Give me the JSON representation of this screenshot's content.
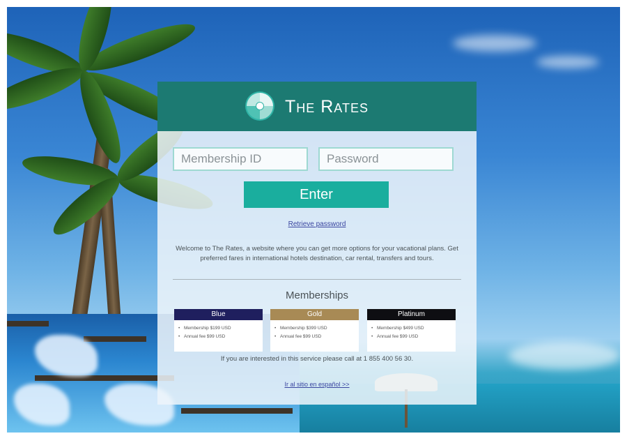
{
  "brand": {
    "name": "The Rates",
    "logo_icon": "swirl-logo-icon",
    "header_color": "#1c7a72"
  },
  "login": {
    "membership_placeholder": "Membership ID",
    "password_placeholder": "Password",
    "enter_label": "Enter",
    "retrieve_label": "Retrieve password",
    "button_color": "#1aae9e"
  },
  "welcome_text": "Welcome to The Rates, a website where you can get more options for your vacational plans. Get preferred fares in international hotels destination, car rental, transfers and tours.",
  "memberships": {
    "title": "Memberships",
    "cards": [
      {
        "name": "Blue",
        "color": "#1f1f5e",
        "items": [
          "Membership $199 USD",
          "Annual fee $99 USD"
        ]
      },
      {
        "name": "Gold",
        "color": "#a88a55",
        "items": [
          "Membership $399 USD",
          "Annual fee $99 USD"
        ]
      },
      {
        "name": "Platinum",
        "color": "#0e0e12",
        "items": [
          "Membership $499 USD",
          "Annual fee $99 USD"
        ]
      }
    ]
  },
  "call_text": "If you are interested in this service please call at 1 855 400 56 30.",
  "spanish_link": "Ir al sitio en español >>"
}
